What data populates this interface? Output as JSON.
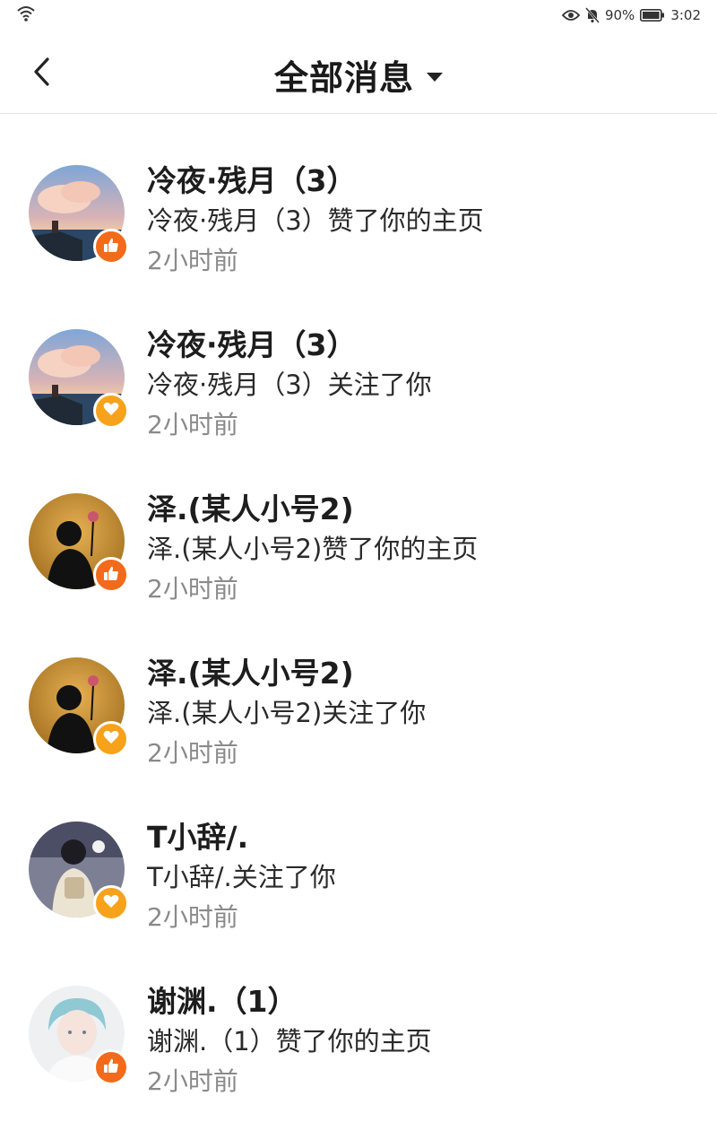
{
  "status_bar": {
    "battery": "90%",
    "time": "3:02",
    "icons": [
      "wifi-icon",
      "eye-icon",
      "mute-bell-icon",
      "battery-icon"
    ]
  },
  "header": {
    "title": "全部消息",
    "icons": [
      "back-arrow-icon",
      "dropdown-caret-icon"
    ]
  },
  "colors": {
    "like_badge": "#f26a1b",
    "follow_badge": "#f7a21b",
    "time_text": "#8a8a8a"
  },
  "messages": [
    {
      "name": "冷夜·残月（3）",
      "text": "冷夜·残月（3）赞了你的主页",
      "time": "2小时前",
      "type": "like",
      "avatar": "sunset-sea-avatar"
    },
    {
      "name": "冷夜·残月（3）",
      "text": "冷夜·残月（3）关注了你",
      "time": "2小时前",
      "type": "follow",
      "avatar": "sunset-sea-avatar"
    },
    {
      "name": "泽.(某人小号2)",
      "text": "泽.(某人小号2)赞了你的主页",
      "time": "2小时前",
      "type": "like",
      "avatar": "silhouette-rose-avatar"
    },
    {
      "name": "泽.(某人小号2)",
      "text": "泽.(某人小号2)关注了你",
      "time": "2小时前",
      "type": "follow",
      "avatar": "silhouette-rose-avatar"
    },
    {
      "name": "T小辞/.",
      "text": "T小辞/.关注了你",
      "time": "2小时前",
      "type": "follow",
      "avatar": "girl-backpack-avatar"
    },
    {
      "name": "谢渊.（1）",
      "text": "谢渊.（1）赞了你的主页",
      "time": "2小时前",
      "type": "like",
      "avatar": "anime-boy-avatar"
    }
  ]
}
